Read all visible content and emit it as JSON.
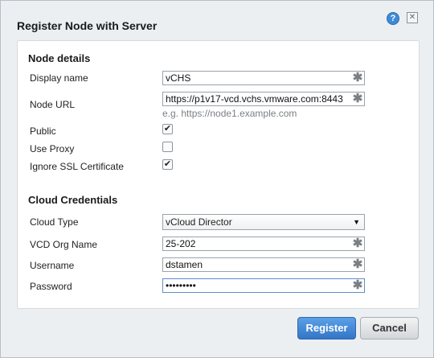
{
  "dialog": {
    "title": "Register Node with Server",
    "help_icon": "?",
    "close_icon": "✕"
  },
  "node_details": {
    "heading": "Node details",
    "display_name_label": "Display name",
    "display_name_value": "vCHS",
    "node_url_label": "Node URL",
    "node_url_value": "https://p1v17-vcd.vchs.vmware.com:8443",
    "node_url_hint": "e.g. https://node1.example.com",
    "public_label": "Public",
    "public_checked": true,
    "use_proxy_label": "Use Proxy",
    "use_proxy_checked": false,
    "ignore_ssl_label": "Ignore SSL Certificate",
    "ignore_ssl_checked": true
  },
  "cloud_credentials": {
    "heading": "Cloud Credentials",
    "cloud_type_label": "Cloud Type",
    "cloud_type_value": "vCloud Director",
    "org_name_label": "VCD Org Name",
    "org_name_value": "25-202",
    "username_label": "Username",
    "username_value": "dstamen",
    "password_label": "Password",
    "password_value": "•••••••••"
  },
  "required_marker": "✱",
  "checkmark": "✔",
  "dropdown_arrow": "▼",
  "buttons": {
    "register": "Register",
    "cancel": "Cancel"
  },
  "colors": {
    "primary_button": "#3f85d6",
    "help_icon": "#3f8ad6"
  }
}
